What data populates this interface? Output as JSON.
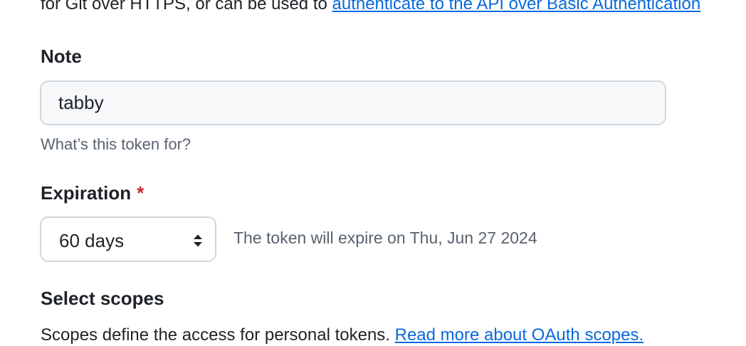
{
  "intro": {
    "text": "for Git over HTTPS, or can be used to ",
    "link": "authenticate to the API over Basic Authentication"
  },
  "note": {
    "label": "Note",
    "value": "tabby",
    "hint": "What’s this token for?"
  },
  "expiration": {
    "label": "Expiration",
    "required_marker": "*",
    "selected": "60 days",
    "note": "The token will expire on Thu, Jun 27 2024"
  },
  "scopes": {
    "heading": "Select scopes",
    "description": "Scopes define the access for personal tokens. ",
    "link": "Read more about OAuth scopes."
  },
  "colors": {
    "link": "#0969da",
    "required": "#d1242f",
    "muted": "#59636e",
    "text": "#1f2328",
    "border": "#d0d7de",
    "input_bg": "#f6f8fa"
  },
  "icons": {
    "select_arrows": "chevron-up-down-icon"
  }
}
